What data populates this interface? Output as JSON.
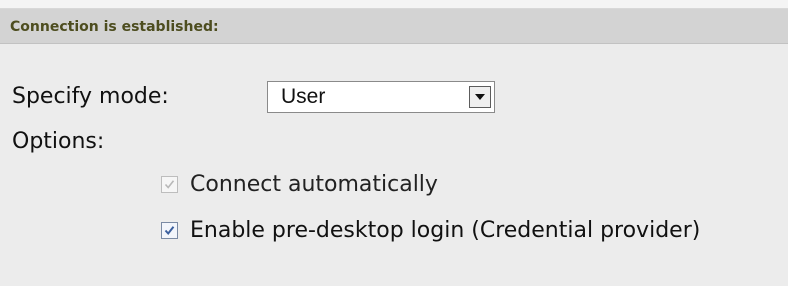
{
  "header": {
    "title": "Connection is established:"
  },
  "mode": {
    "label": "Specify mode:",
    "selected_value": "User"
  },
  "options": {
    "label": "Options:",
    "items": [
      {
        "label": "Connect automatically",
        "checked": true,
        "disabled": true
      },
      {
        "label": "Enable pre-desktop login (Credential provider)",
        "checked": true,
        "disabled": false
      }
    ]
  },
  "icons": {
    "dropdown": "chevron-down-icon",
    "check": "checkmark-icon"
  },
  "colors": {
    "header_bg": "#d3d3d3",
    "header_text": "#4d4d1f",
    "panel_bg": "#ececec",
    "check_enabled": "#3b5f9e",
    "check_disabled": "#b8b8b8"
  }
}
